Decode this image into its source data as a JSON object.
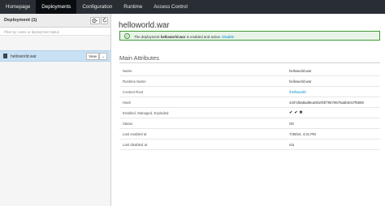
{
  "nav": {
    "tabs": [
      {
        "label": "Homepage"
      },
      {
        "label": "Deployments",
        "active": true
      },
      {
        "label": "Configuration"
      },
      {
        "label": "Runtime"
      },
      {
        "label": "Access Control"
      }
    ]
  },
  "sidebar": {
    "title": "Deployment",
    "count": "(1)",
    "filter_placeholder": "Filter by: name or deployment status",
    "items": [
      {
        "label": "helloworld.war",
        "view_label": "View",
        "caret": "⌄",
        "icon": "war-file-icon"
      }
    ],
    "gear_icon": "gear-icon",
    "refresh_icon": "refresh-icon"
  },
  "main": {
    "title": "helloworld.war",
    "alert": {
      "prefix": "The deployment ",
      "name": "helloworld.war",
      "middle": " is enabled and active. ",
      "link": "Disable",
      "icon": "check-circle-icon",
      "color": "#3f9c35"
    },
    "section_title": "Main Attributes",
    "attributes": [
      {
        "label": "Name",
        "value": "helloworld.war"
      },
      {
        "label": "Runtime Name",
        "value": "helloworld.war"
      },
      {
        "label": "Context Root",
        "value": "/helloworld"
      },
      {
        "label": "Hash",
        "value": "4407d5a8ad9ea0819f4f79678675a6b0c57f5608"
      },
      {
        "label": "Enabled, Managed, Exploded",
        "flags": [
          "✔",
          "✔",
          "✖"
        ]
      },
      {
        "label": "Status",
        "value": "OK"
      },
      {
        "label": "Last enabled at",
        "value": "7/30/24, 4:31 PM"
      },
      {
        "label": "Last disabled at",
        "value": "n/a"
      }
    ]
  },
  "colors": {
    "nav_bg": "#292e34",
    "nav_active": "#0a0d10",
    "selected_row": "#c9e1f4",
    "link": "#0088ce"
  }
}
